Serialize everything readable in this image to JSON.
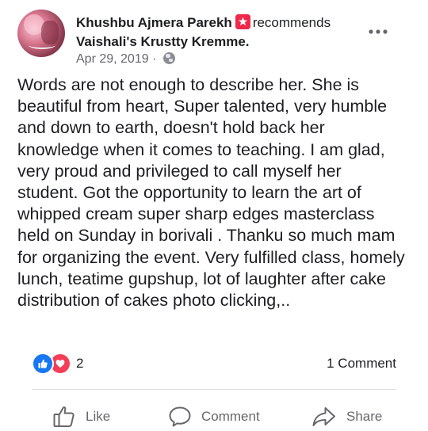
{
  "post": {
    "author": "Khushbu Ajmera Parekh",
    "action_word": "recommends",
    "page_name": "Vaishali's Krustty Kremme.",
    "date": "Apr 29, 2019",
    "date_separator": "·",
    "privacy_icon": "globe-icon",
    "badge_color": "#f0284a",
    "body": "Words are not enough to describe her. She is beautiful from heart, Super talented, very humble and down to earth, doesn't hold back her knowledge when it comes to teaching. I am glad, very proud and privileged to call myself her student. Got the opportunity to learn the art of whipped cream super sharp edges masterclass held on Sunday in borivali . Thanku so much mam for organizing the event. Very fulfilled class, homely lunch, teatime gupshup, lot of laughter after cake distribution of cakes photo clicking,.."
  },
  "stats": {
    "reaction_count": "2",
    "comment_count": "1 Comment",
    "reaction_icons": [
      "like-icon",
      "love-icon"
    ]
  },
  "actions": {
    "like": "Like",
    "comment": "Comment",
    "share": "Share"
  },
  "colors": {
    "like_blue": "#1877f2",
    "love_red": "#f33e58",
    "muted": "#65676b"
  }
}
